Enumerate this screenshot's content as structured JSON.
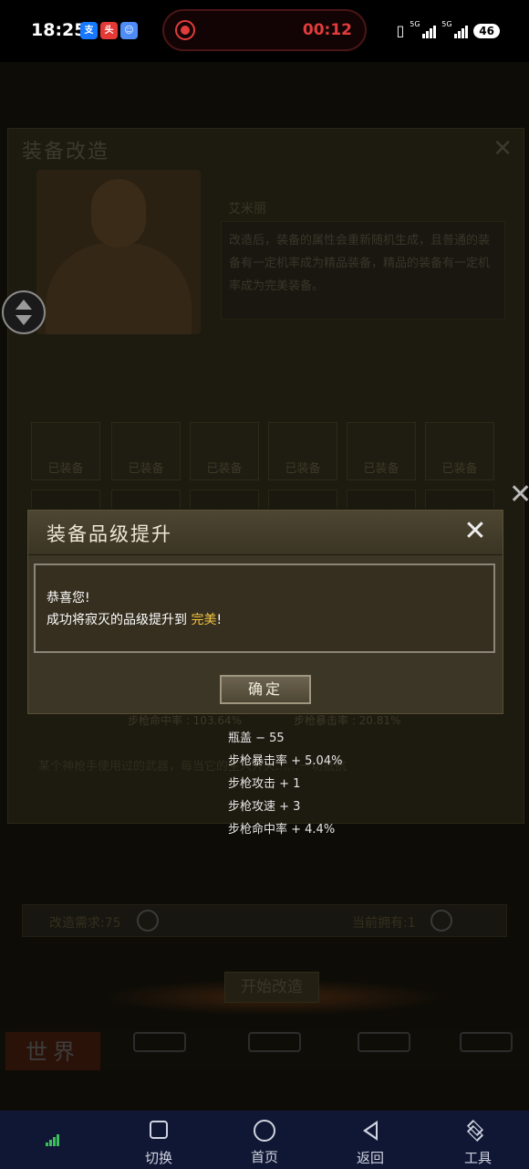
{
  "status_bar": {
    "time": "18:25",
    "apps": [
      {
        "icon": "alipay-icon",
        "text": "支",
        "color": "#1677ff"
      },
      {
        "icon": "news-app-icon",
        "text": "头",
        "color": "#e53935"
      },
      {
        "icon": "face-app-icon",
        "text": "☺",
        "color": "#4f8cf7"
      }
    ],
    "recording_time": "00:12",
    "network_1": "5G",
    "network_2": "5G",
    "battery": "46"
  },
  "background": {
    "panel_title": "装备改造",
    "npc_name": "艾米丽",
    "description": "改造后，装备的属性会重新随机生成，且普通的装备有一定机率成为精品装备，精品的装备有一定机率成为完美装备。",
    "equip_labels": [
      "已装备",
      "已装备",
      "已装备",
      "已装备",
      "已装备",
      "已装备"
    ],
    "stat_left": "步枪命中率 : 103.64%",
    "stat_right": "步枪暴击率 : 20.81%",
    "flavor_text": "某个神枪手使用过的武器，每当它的主人开火……一切抵抗",
    "requirement": "改造需求:75",
    "owned": "当前拥有:1",
    "start_button": "开始改造",
    "world_button": "世界"
  },
  "dialog": {
    "title": "装备品级提升",
    "line1": "恭喜您!",
    "line2_prefix": "成功将寂灭的品级提升到",
    "quality": "完美",
    "line2_suffix": "!",
    "confirm": "确定"
  },
  "stats": [
    "瓶盖 − 55",
    "步枪暴击率 + 5.04%",
    "步枪攻击 + 1",
    "步枪攻速 + 3",
    "步枪命中率 + 4.4%"
  ],
  "nav": {
    "switch": "切换",
    "home": "首页",
    "back": "返回",
    "tools": "工具"
  },
  "colors": {
    "highlight": "#f3c542",
    "navbar": "#101734",
    "dialog_bg": "#3b3626"
  }
}
